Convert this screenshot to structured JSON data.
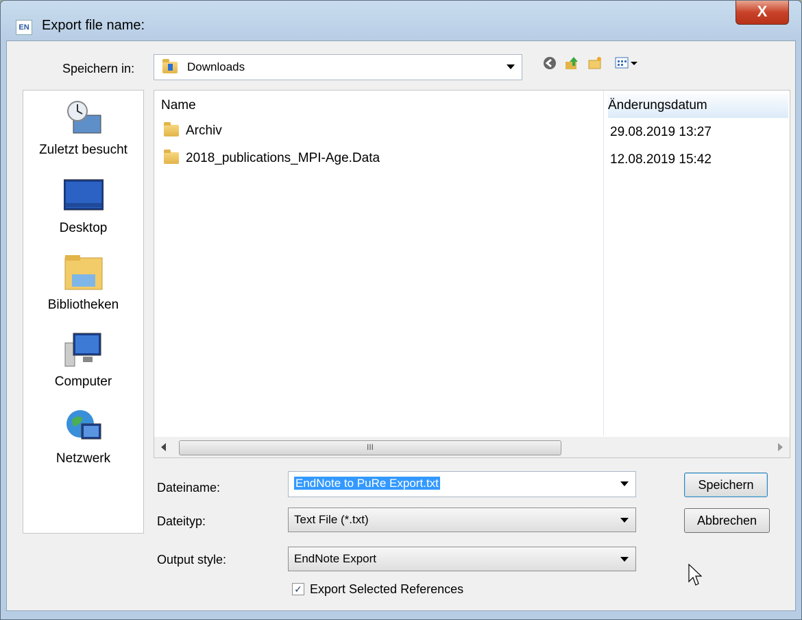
{
  "window": {
    "title": "Export file name:",
    "app_icon_text": "EN",
    "close_symbol": "X"
  },
  "toolbar": {
    "save_in_label": "Speichern in:",
    "location": "Downloads",
    "icons": [
      "back-icon",
      "up-folder-icon",
      "new-folder-icon",
      "view-menu-icon"
    ]
  },
  "places": [
    {
      "label": "Zuletzt besucht",
      "icon": "recent-places-icon"
    },
    {
      "label": "Desktop",
      "icon": "desktop-icon"
    },
    {
      "label": "Bibliotheken",
      "icon": "libraries-icon"
    },
    {
      "label": "Computer",
      "icon": "computer-icon"
    },
    {
      "label": "Netzwerk",
      "icon": "network-icon"
    }
  ],
  "file_list": {
    "columns": [
      "Name",
      "Änderungsdatum"
    ],
    "rows": [
      {
        "name": "Archiv",
        "date": "29.08.2019 13:27"
      },
      {
        "name": "2018_publications_MPI-Age.Data",
        "date": "12.08.2019 15:42"
      }
    ],
    "scroll_grip": "III"
  },
  "form": {
    "filename_label": "Dateiname:",
    "filename_value": "EndNote to PuRe Export.txt",
    "filetype_label": "Dateityp:",
    "filetype_value": "Text File (*.txt)",
    "output_style_label": "Output style:",
    "output_style_value": "EndNote Export",
    "export_selected_label": "Export Selected References",
    "export_selected_checked": true
  },
  "buttons": {
    "save": "Speichern",
    "cancel": "Abbrechen"
  }
}
